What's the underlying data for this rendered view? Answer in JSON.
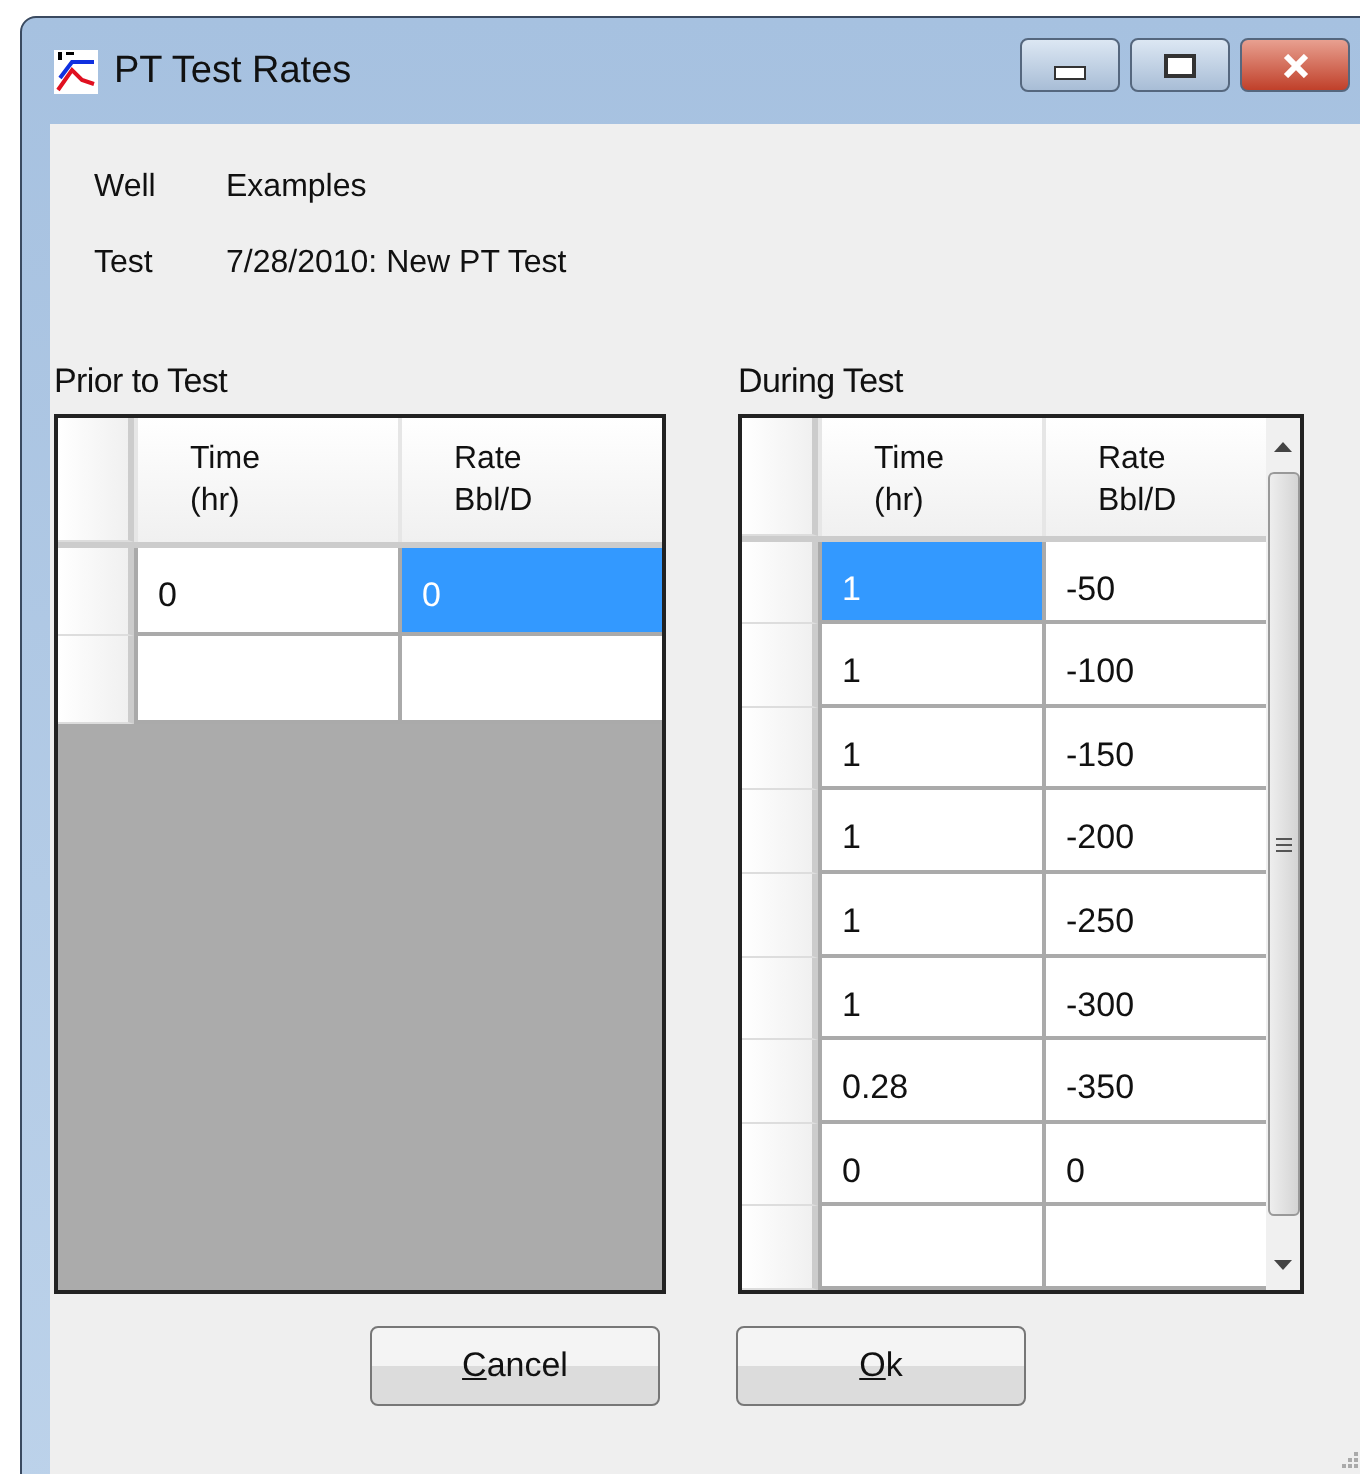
{
  "window": {
    "title": "PT Test Rates"
  },
  "info": [
    {
      "label": "Well",
      "value": "Examples"
    },
    {
      "label": "Test",
      "value": "7/28/2010: New PT Test"
    }
  ],
  "grids": [
    {
      "title": "Prior to Test",
      "columns": [
        "Time\n(hr)",
        "Rate\nBbl/D"
      ],
      "scrollbar": false,
      "rows": [
        {
          "cells": [
            {
              "text": "0",
              "selected": false
            },
            {
              "text": "0",
              "selected": true
            }
          ]
        },
        {
          "cells": [
            {
              "selected": false
            },
            {
              "selected": false
            }
          ]
        }
      ]
    },
    {
      "title": "During Test",
      "columns": [
        "Time\n(hr)",
        "Rate\nBbl/D"
      ],
      "scrollbar": true,
      "rows": [
        {
          "cells": [
            {
              "text": "1",
              "selected": true
            },
            {
              "text": "-50",
              "selected": false
            }
          ]
        },
        {
          "cells": [
            {
              "text": "1",
              "selected": false
            },
            {
              "text": "-100",
              "selected": false
            }
          ]
        },
        {
          "cells": [
            {
              "text": "1",
              "selected": false
            },
            {
              "text": "-150",
              "selected": false
            }
          ]
        },
        {
          "cells": [
            {
              "text": "1",
              "selected": false
            },
            {
              "text": "-200",
              "selected": false
            }
          ]
        },
        {
          "cells": [
            {
              "text": "1",
              "selected": false
            },
            {
              "text": "-250",
              "selected": false
            }
          ]
        },
        {
          "cells": [
            {
              "text": "1",
              "selected": false
            },
            {
              "text": "-300",
              "selected": false
            }
          ]
        },
        {
          "cells": [
            {
              "text": "0.28",
              "selected": false
            },
            {
              "text": "-350",
              "selected": false
            }
          ]
        },
        {
          "cells": [
            {
              "text": "0",
              "selected": false
            },
            {
              "text": "0",
              "selected": false
            }
          ]
        },
        {
          "cells": [
            {
              "selected": false
            },
            {
              "selected": false
            }
          ]
        }
      ]
    }
  ],
  "buttons": [
    {
      "label": "Cancel"
    },
    {
      "label": "Ok"
    }
  ]
}
